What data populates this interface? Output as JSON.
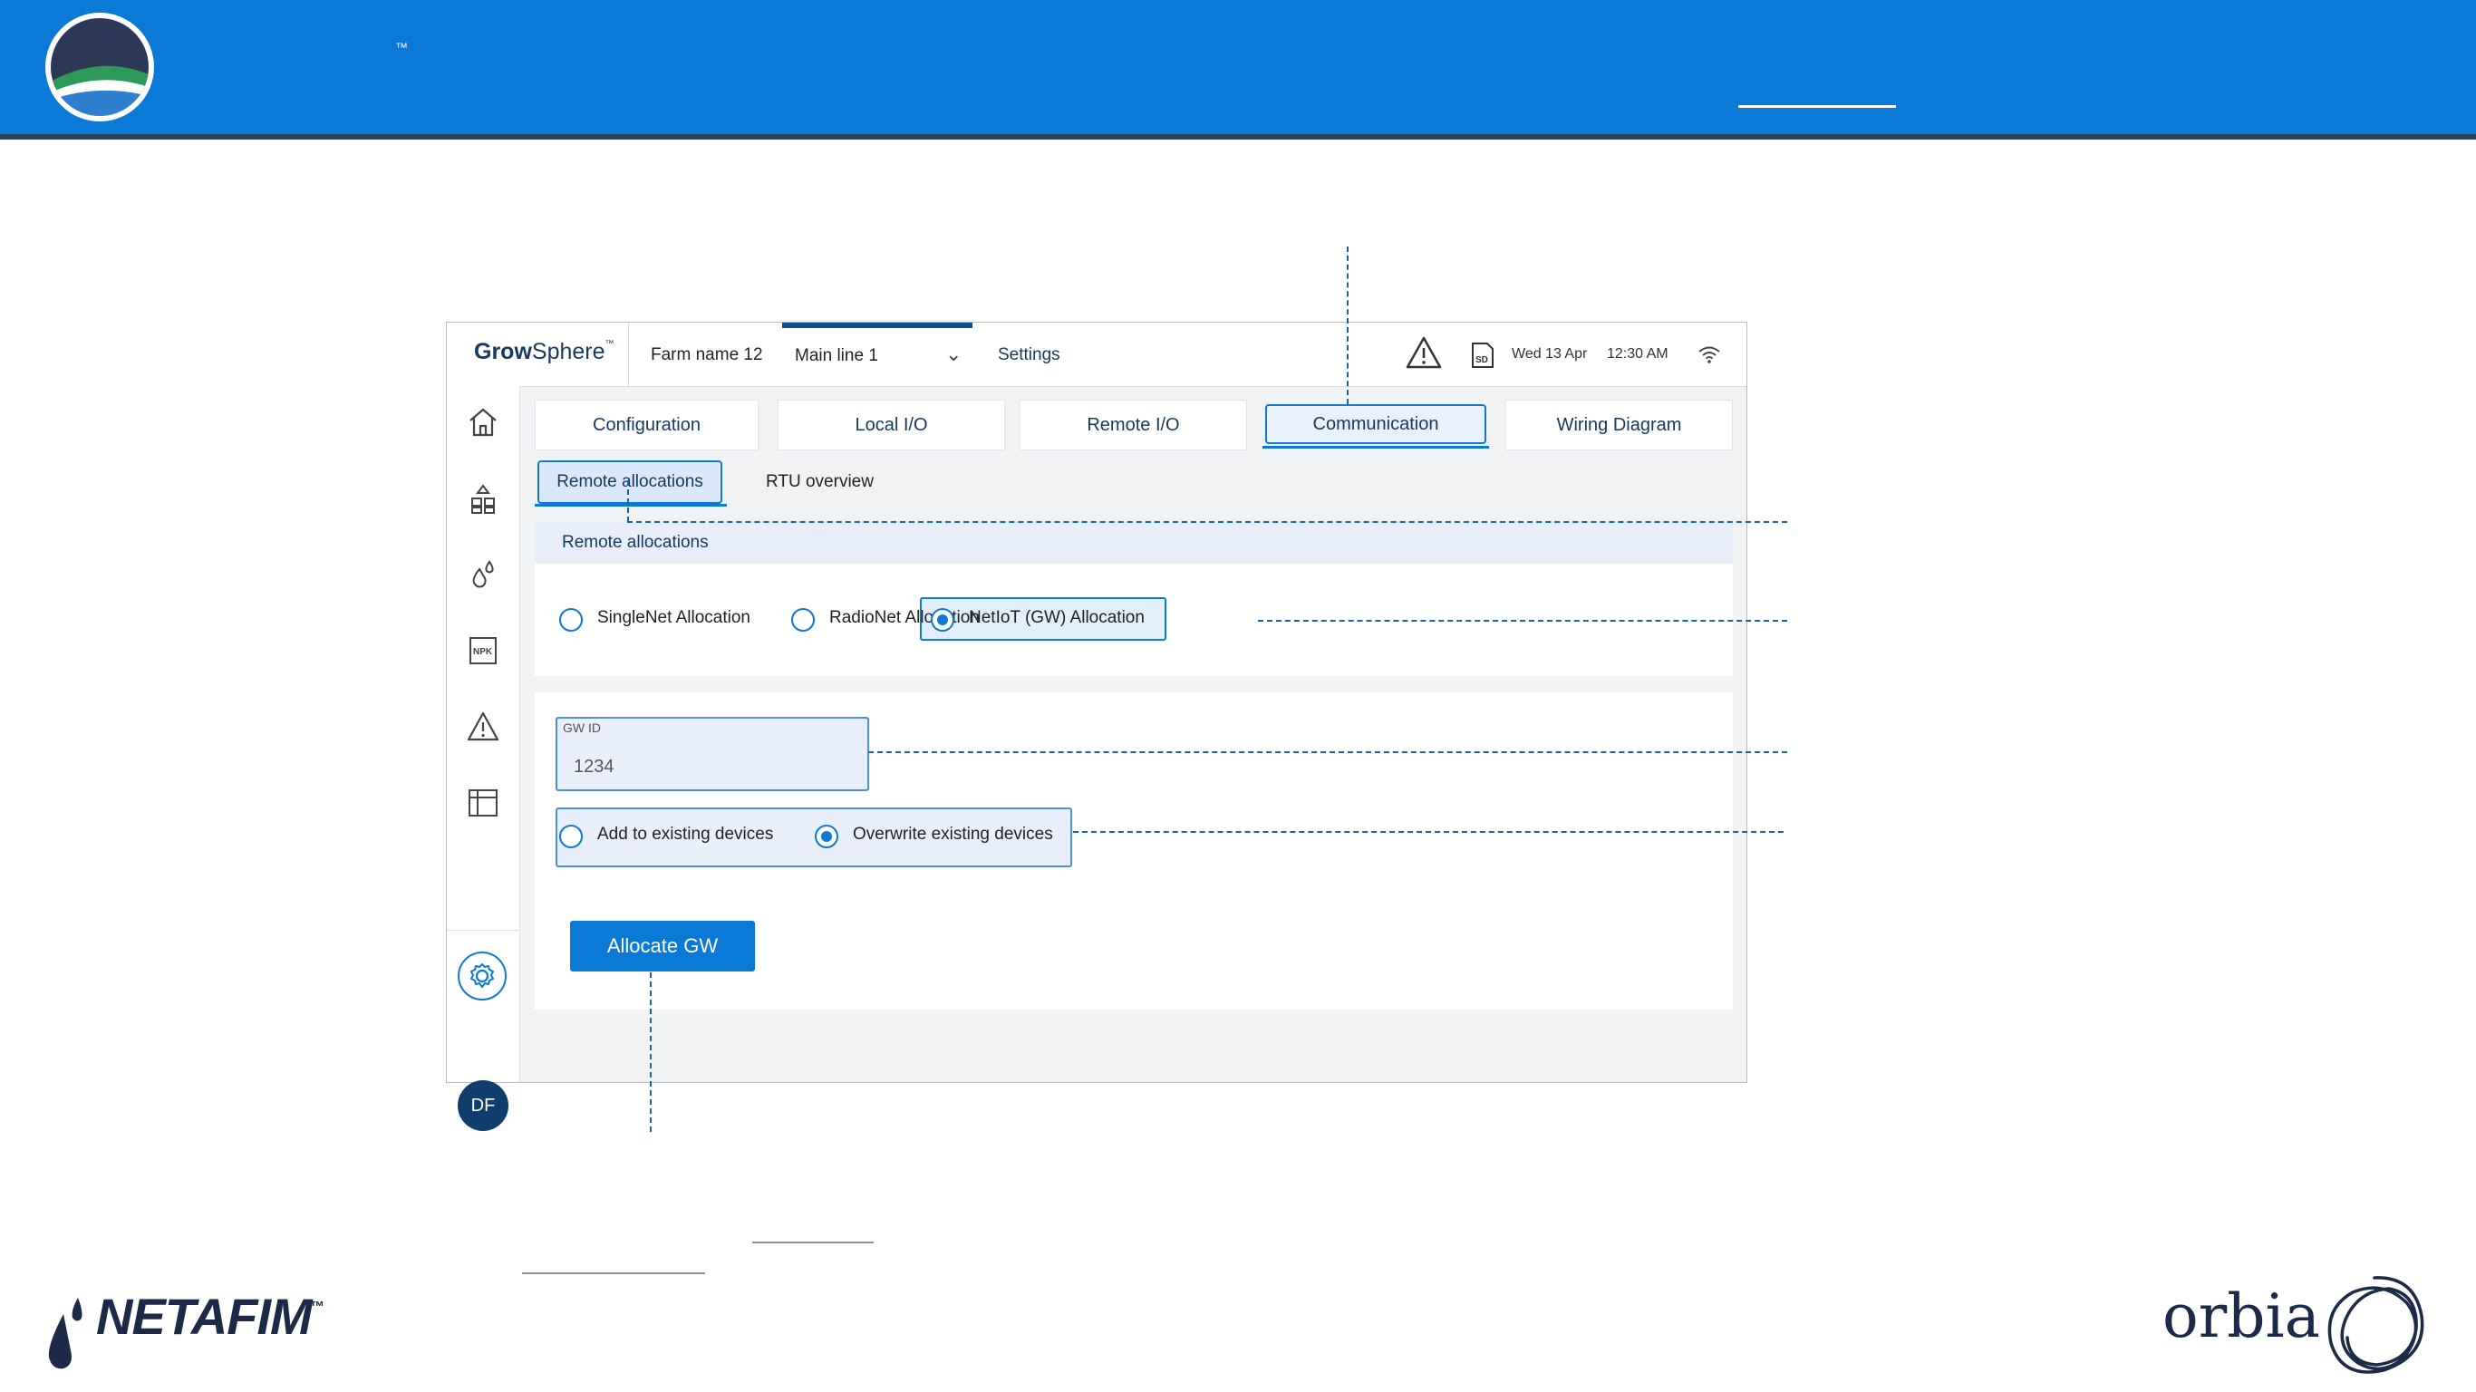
{
  "top_banner": {
    "trademark": "™"
  },
  "app": {
    "brand": {
      "name_bold": "Grow",
      "name_rest": "Sphere",
      "tm": "™"
    },
    "header": {
      "farm_name": "Farm name 12",
      "main_line": "Main line 1",
      "settings": "Settings",
      "date": "Wed 13 Apr",
      "time": "12:30 AM"
    },
    "tabs": [
      "Configuration",
      "Local I/O",
      "Remote  I/O",
      "Communication",
      "Wiring Diagram"
    ],
    "active_tab": "Communication",
    "subtabs": [
      "Remote allocations",
      "RTU overview"
    ],
    "panel_title": "Remote allocations",
    "allocation_options": [
      "SingleNet Allocation",
      "RadioNet Allocation",
      "NetIoT (GW) Allocation"
    ],
    "selected_allocation": "NetIoT (GW) Allocation",
    "gw_id": {
      "label": "GW ID",
      "value": "1234"
    },
    "device_options": [
      "Add to existing devices",
      "Overwrite existing devices"
    ],
    "selected_device_option": "Overwrite existing devices",
    "allocate_button": "Allocate GW",
    "user_initials": "DF"
  },
  "footer": {
    "netafim": "NETAFIM",
    "netafim_tm": "™",
    "orbia": "orbia"
  },
  "colors": {
    "accent": "#0b7ad6",
    "navy": "#173a60",
    "callout": "#1565a8"
  }
}
